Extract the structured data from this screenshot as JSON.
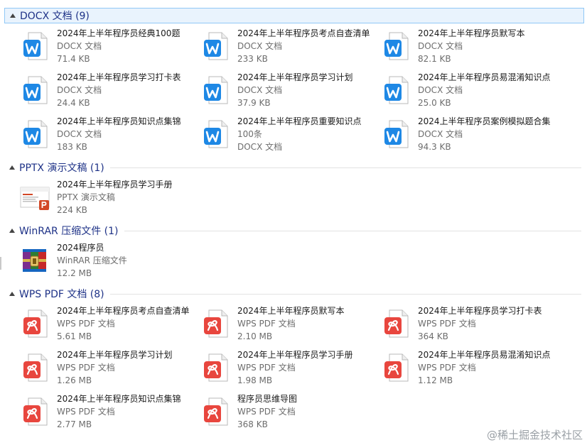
{
  "groups": [
    {
      "title": "DOCX 文档 (9)",
      "items": [
        {
          "lines": [
            "2024年上半年程序员经典100题",
            "DOCX 文档",
            "71.4 KB"
          ],
          "icon": "word-doc-icon"
        },
        {
          "lines": [
            "2024年上半年程序员考点自查清单",
            "DOCX 文档",
            "233 KB"
          ],
          "icon": "word-doc-icon"
        },
        {
          "lines": [
            "2024年上半年程序员默写本",
            "DOCX 文档",
            "82.1 KB"
          ],
          "icon": "word-doc-icon"
        },
        {
          "lines": [
            "2024年上半年程序员学习打卡表",
            "DOCX 文档",
            "24.4 KB"
          ],
          "icon": "word-doc-icon"
        },
        {
          "lines": [
            "2024年上半年程序员学习计划",
            "DOCX 文档",
            "37.9 KB"
          ],
          "icon": "word-doc-icon"
        },
        {
          "lines": [
            "2024年上半年程序员易混淆知识点",
            "DOCX 文档",
            "25.0 KB"
          ],
          "icon": "word-doc-icon"
        },
        {
          "lines": [
            "2024年上半年程序员知识点集锦",
            "DOCX 文档",
            "183 KB"
          ],
          "icon": "word-doc-icon"
        },
        {
          "lines": [
            "2024年上半年程序员重要知识点",
            "100条",
            "DOCX 文档"
          ],
          "icon": "word-doc-icon"
        },
        {
          "lines": [
            "2024上半年程序员案例模拟题合集",
            "DOCX 文档",
            "94.3 KB"
          ],
          "icon": "word-doc-icon"
        }
      ]
    },
    {
      "title": "PPTX 演示文稿 (1)",
      "items": [
        {
          "lines": [
            "2024年上半年程序员学习手册",
            "PPTX 演示文稿",
            "224 KB"
          ],
          "icon": "pptx-thumbnail-icon"
        }
      ]
    },
    {
      "title": "WinRAR 压缩文件 (1)",
      "items": [
        {
          "lines": [
            "2024程序员",
            "WinRAR 压缩文件",
            "12.2 MB"
          ],
          "icon": "winrar-archive-icon"
        }
      ]
    },
    {
      "title": "WPS PDF 文档 (8)",
      "items": [
        {
          "lines": [
            "2024年上半年程序员考点自查清单",
            "WPS PDF 文档",
            "5.61 MB"
          ],
          "icon": "wps-pdf-icon"
        },
        {
          "lines": [
            "2024年上半年程序员默写本",
            "WPS PDF 文档",
            "2.10 MB"
          ],
          "icon": "wps-pdf-icon"
        },
        {
          "lines": [
            "2024年上半年程序员学习打卡表",
            "WPS PDF 文档",
            "364 KB"
          ],
          "icon": "wps-pdf-icon"
        },
        {
          "lines": [
            "2024年上半年程序员学习计划",
            "WPS PDF 文档",
            "1.26 MB"
          ],
          "icon": "wps-pdf-icon"
        },
        {
          "lines": [
            "2024年上半年程序员学习手册",
            "WPS PDF 文档",
            "1.98 MB"
          ],
          "icon": "wps-pdf-icon"
        },
        {
          "lines": [
            "2024年上半年程序员易混淆知识点",
            "WPS PDF 文档",
            "1.12 MB"
          ],
          "icon": "wps-pdf-icon"
        },
        {
          "lines": [
            "2024年上半年程序员知识点集锦",
            "WPS PDF 文档",
            "2.77 MB"
          ],
          "icon": "wps-pdf-icon"
        },
        {
          "lines": [
            "程序员思维导图",
            "WPS PDF 文档",
            "368 KB"
          ],
          "icon": "wps-pdf-icon"
        }
      ]
    }
  ],
  "watermark": "@稀土掘金技术社区",
  "colors": {
    "group_title": "#1e3287",
    "selection_border": "#90c8f6",
    "selection_fill": "#e9f3fd",
    "word_blue": "#1e88e5",
    "pdf_red": "#e8463e"
  }
}
